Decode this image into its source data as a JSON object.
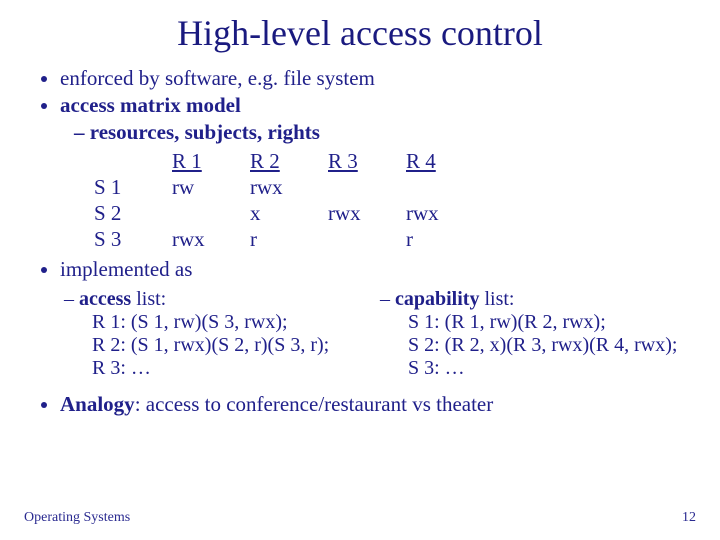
{
  "title": "High-level access control",
  "bullets": {
    "b1": "enforced by software, e.g. file system",
    "b2_strong": "access matrix model",
    "b2_sub": "resources, subjects, rights",
    "b3": "implemented as",
    "b4_prefix": "Analogy",
    "b4_rest": ": access to conference/restaurant vs theater"
  },
  "matrix": {
    "headers": {
      "c1": "R 1",
      "c2": "R 2",
      "c3": "R 3",
      "c4": "R 4"
    },
    "rows": [
      {
        "label": "S 1",
        "c1": "rw",
        "c2": "rwx",
        "c3": "",
        "c4": ""
      },
      {
        "label": "S 2",
        "c1": "",
        "c2": "x",
        "c3": "rwx",
        "c4": "rwx"
      },
      {
        "label": "S 3",
        "c1": "rwx",
        "c2": "r",
        "c3": "",
        "c4": "r"
      }
    ]
  },
  "access_list": {
    "head_strong": "access",
    "head_rest": " list:",
    "l1": "R 1: (S 1, rw)(S 3, rwx);",
    "l2": "R 2: (S 1, rwx)(S 2, r)(S 3, r);",
    "l3": "R 3: …"
  },
  "capability_list": {
    "head_strong": "capability",
    "head_rest": " list:",
    "l1": "S 1: (R 1, rw)(R 2, rwx);",
    "l2": "S 2: (R 2, x)(R 3, rwx)(R 4, rwx);",
    "l3": "S 3: …"
  },
  "footer": {
    "left": "Operating Systems",
    "right": "12"
  }
}
